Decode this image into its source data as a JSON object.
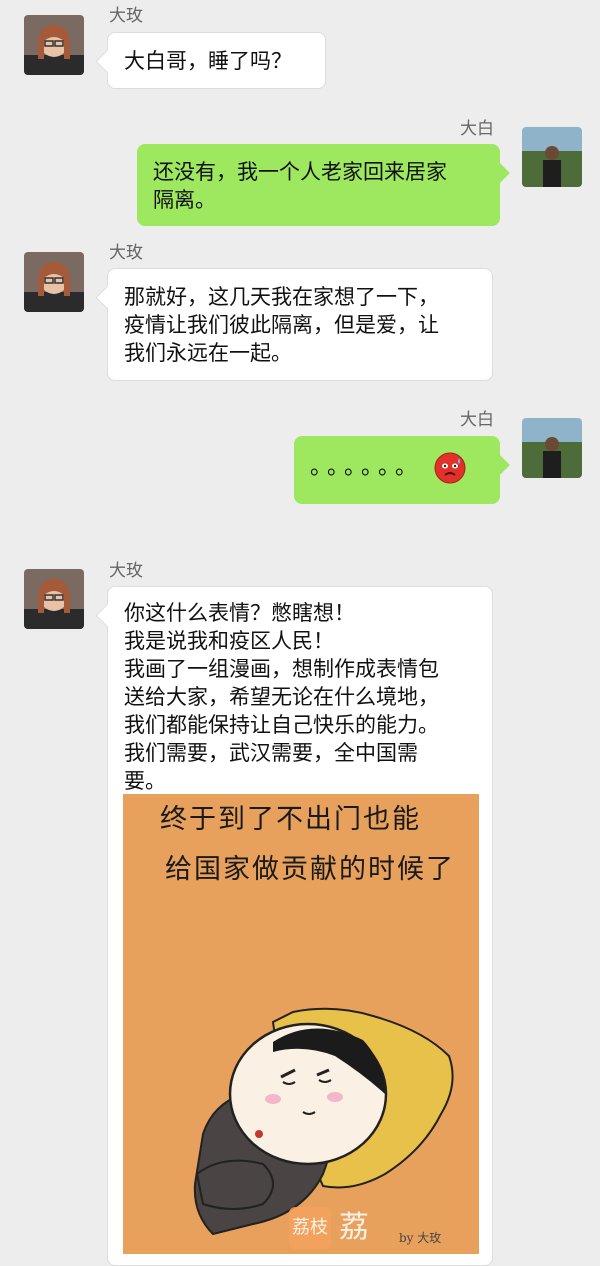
{
  "messages": [
    {
      "sender": "大玫",
      "side": "left",
      "lines": [
        "大白哥，睡了吗？"
      ]
    },
    {
      "sender": "大白",
      "side": "right",
      "lines": [
        "还没有，我一个人老家回来居家",
        "隔离。"
      ]
    },
    {
      "sender": "大玫",
      "side": "left",
      "lines": [
        "那就好，这几天我在家想了一下，",
        "疫情让我们彼此隔离，但是爱，让",
        "我们永远在一起。"
      ]
    },
    {
      "sender": "大白",
      "side": "right",
      "text": "。。。。。。",
      "emoji": "sweating-face-emoji"
    },
    {
      "sender": "大玫",
      "side": "left",
      "lines": [
        "你这什么表情？憋瞎想！",
        "我是说我和疫区人民！",
        "我画了一组漫画，想制作成表情包",
        "送给大家，希望无论在什么境地，",
        "我们都能保持让自己快乐的能力。",
        "我们需要，武汉需要，全中国需",
        "要。"
      ]
    }
  ],
  "comic": {
    "line1": "终于到了不出门也能",
    "line2": "给国家做贡献的时候了",
    "signature": "by 大玫"
  },
  "watermark": {
    "badge": "荔枝",
    "text": "荔"
  },
  "colors": {
    "background": "#ededed",
    "green_bubble": "#9de85f",
    "comic_bg": "#e7a15c"
  }
}
